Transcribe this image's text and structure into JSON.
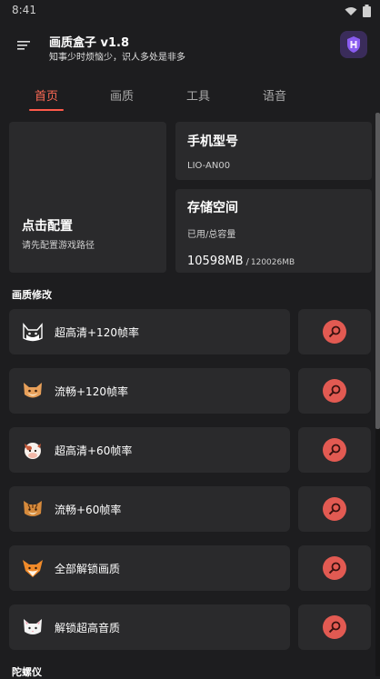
{
  "status": {
    "time": "8:41"
  },
  "header": {
    "title": "画质盒子 v1.8",
    "subtitle": "知事少时烦恼少，识人多处是非多"
  },
  "tabs": [
    {
      "label": "首页",
      "active": true
    },
    {
      "label": "画质",
      "active": false
    },
    {
      "label": "工具",
      "active": false
    },
    {
      "label": "语音",
      "active": false
    }
  ],
  "config_card": {
    "title": "点击配置",
    "subtitle": "请先配置游戏路径"
  },
  "phone_card": {
    "title": "手机型号",
    "model": "LIO-AN00"
  },
  "storage_card": {
    "title": "存储空间",
    "label": "已用/总容量",
    "used": "10598MB",
    "separator": "/",
    "total": "120026MB"
  },
  "sections": {
    "quality": "画质修改",
    "gyro": "陀螺仪"
  },
  "options": [
    {
      "label": "超高清+120帧率",
      "icon": "cat-face-icon"
    },
    {
      "label": "流畅+120帧率",
      "icon": "fox-face-icon"
    },
    {
      "label": "超高清+60帧率",
      "icon": "cow-face-icon"
    },
    {
      "label": "流畅+60帧率",
      "icon": "tiger-face-icon"
    },
    {
      "label": "全部解锁画质",
      "icon": "fox-icon"
    },
    {
      "label": "解锁超高音质",
      "icon": "white-cat-icon"
    }
  ],
  "colors": {
    "accent": "#ff5a4a",
    "button": "#e25a52",
    "card": "#2a2a2c",
    "background": "#1d1d1f"
  }
}
